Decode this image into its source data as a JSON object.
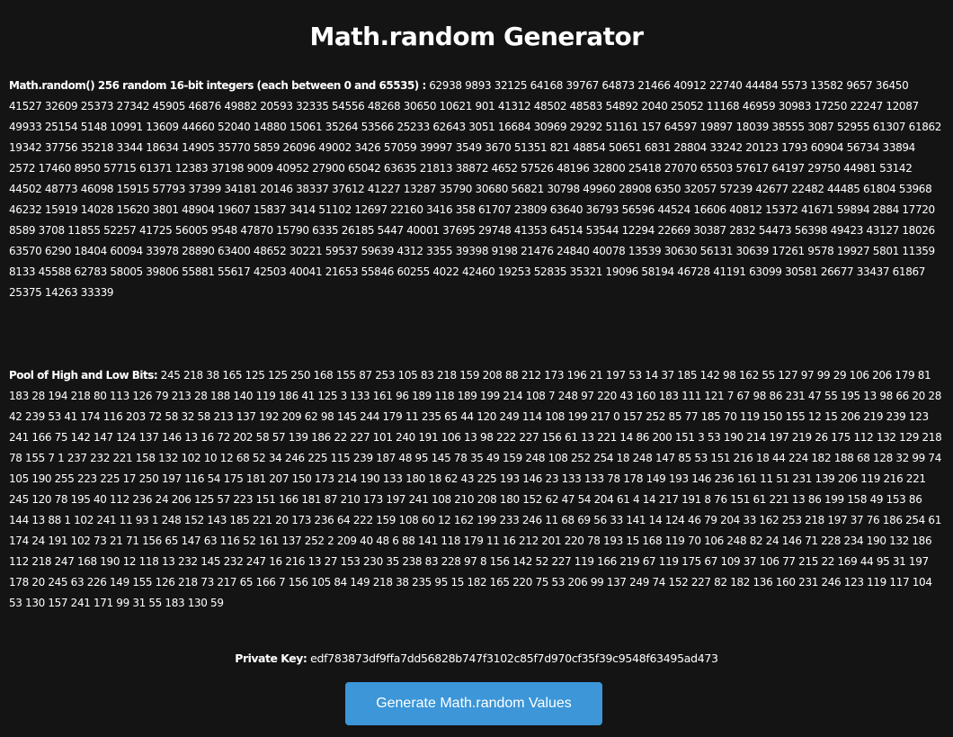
{
  "title": "Math.random Generator",
  "random_section": {
    "label": "Math.random() 256 random 16-bit integers (each between 0 and 65535) :",
    "values": "62938 9893 32125 64168 39767 64873 21466 40912 22740 44484 5573 13582 9657 36450 41527 32609 25373 27342 45905 46876 49882 20593 32335 54556 48268 30650 10621 901 41312 48502 48583 54892 2040 25052 11168 46959 30983 17250 22247 12087 49933 25154 5148 10991 13609 44660 52040 14880 15061 35264 53566 25233 62643 3051 16684 30969 29292 51161 157 64597 19897 18039 38555 3087 52955 61307 61862 19342 37756 35218 3344 18634 14905 35770 5859 26096 49002 3426 57059 39997 3549 3670 51351 821 48854 50651 6831 28804 33242 20123 1793 60904 56734 33894 2572 17460 8950 57715 61371 12383 37198 9009 40952 27900 65042 63635 21813 38872 4652 57526 48196 32800 25418 27070 65503 57617 64197 29750 44981 53142 44502 48773 46098 15915 57793 37399 34181 20146 38337 37612 41227 13287 35790 30680 56821 30798 49960 28908 6350 32057 57239 42677 22482 44485 61804 53968 46232 15919 14028 15620 3801 48904 19607 15837 3414 51102 12697 22160 3416 358 61707 23809 63640 36793 56596 44524 16606 40812 15372 41671 59894 2884 17720 8589 3708 11855 52257 41725 56005 9548 47870 15790 6335 26185 5447 40001 37695 29748 41353 64514 53544 12294 22669 30387 2832 54473 56398 49423 43127 18026 63570 6290 18404 60094 33978 28890 63400 48652 30221 59537 59639 4312 3355 39398 9198 21476 24840 40078 13539 30630 56131 30639 17261 9578 19927 5801 11359 8133 45588 62783 58005 39806 55881 55617 42503 40041 21653 55846 60255 4022 42460 19253 52835 35321 19096 58194 46728 41191 63099 30581 26677 33437 61867 25375 14263 33339"
  },
  "pool_section": {
    "label": "Pool of High and Low Bits:",
    "values": "245 218 38 165 125 125 250 168 155 87 253 105 83 218 159 208 88 212 173 196 21 197 53 14 37 185 142 98 162 55 127 97 99 29 106 206 179 81 183 28 194 218 80 113 126 79 213 28 188 140 119 186 41 125 3 133 161 96 189 118 189 199 214 108 7 248 97 220 43 160 183 111 121 7 67 98 86 231 47 55 195 13 98 66 20 28 42 239 53 41 174 116 203 72 58 32 58 213 137 192 209 62 98 145 244 179 11 235 65 44 120 249 114 108 199 217 0 157 252 85 77 185 70 119 150 155 12 15 206 219 239 123 241 166 75 142 147 124 137 146 13 16 72 202 58 57 139 186 22 227 101 240 191 106 13 98 222 227 156 61 13 221 14 86 200 151 3 53 190 214 197 219 26 175 112 132 129 218 78 155 7 1 237 232 221 158 132 102 10 12 68 52 34 246 225 115 239 187 48 95 145 78 35 49 159 248 108 252 254 18 248 147 85 53 151 216 18 44 224 182 188 68 128 32 99 74 105 190 255 223 225 17 250 197 116 54 175 181 207 150 173 214 190 133 180 18 62 43 225 193 146 23 133 133 78 178 149 193 146 236 161 11 51 231 139 206 119 216 221 245 120 78 195 40 112 236 24 206 125 57 223 151 166 181 87 210 173 197 241 108 210 208 180 152 62 47 54 204 61 4 14 217 191 8 76 151 61 221 13 86 199 158 49 153 86 144 13 88 1 102 241 11 93 1 248 152 143 185 221 20 173 236 64 222 159 108 60 12 162 199 233 246 11 68 69 56 33 141 14 124 46 79 204 33 162 253 218 197 37 76 186 254 61 174 24 191 102 73 21 71 156 65 147 63 116 52 161 137 252 2 209 40 48 6 88 141 118 179 11 16 212 201 220 78 193 15 168 119 70 106 248 82 24 146 71 228 234 190 132 186 112 218 247 168 190 12 118 13 232 145 232 247 16 216 13 27 153 230 35 238 83 228 97 8 156 142 52 227 119 166 219 67 119 175 67 109 37 106 77 215 22 169 44 95 31 197 178 20 245 63 226 149 155 126 218 73 217 65 166 7 156 105 84 149 218 38 235 95 15 182 165 220 75 53 206 99 137 249 74 152 227 82 182 136 160 231 246 123 119 117 104 53 130 157 241 171 99 31 55 183 130 59"
  },
  "private_key": {
    "label": "Private Key:",
    "value": "edf783873df9ffa7dd56828b747f3102c85f7d970cf35f39c9548f63495ad473"
  },
  "generate_button": {
    "label": "Generate Math.random Values"
  },
  "colors": {
    "background": "#141414",
    "text": "#ffffff",
    "button": "#3c96d8"
  }
}
